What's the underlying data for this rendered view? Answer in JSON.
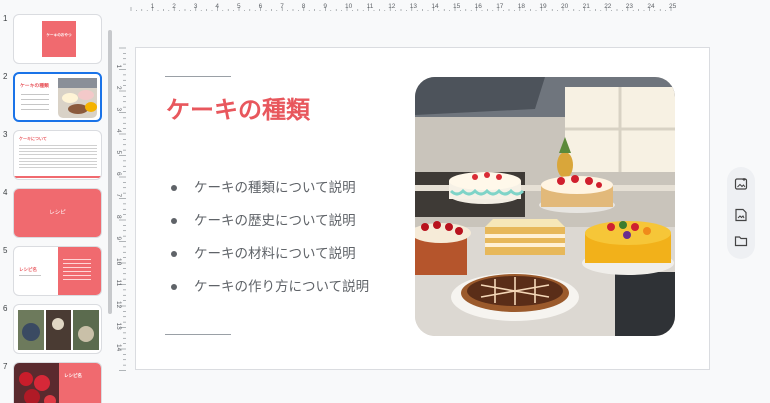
{
  "filmstrip": {
    "thumbnails": [
      {
        "num": "1",
        "title": "ケーキのおやつ",
        "kind": "title"
      },
      {
        "num": "2",
        "title": "ケーキの種類",
        "kind": "bullets-photo",
        "selected": true
      },
      {
        "num": "3",
        "title": "ケーキについて",
        "kind": "text"
      },
      {
        "num": "4",
        "title": "レシピ",
        "kind": "section"
      },
      {
        "num": "5",
        "title": "レシピ名",
        "kind": "split"
      },
      {
        "num": "6",
        "title": "",
        "kind": "gallery"
      },
      {
        "num": "7",
        "title": "レシピ名",
        "kind": "photo-split"
      }
    ]
  },
  "ruler": {
    "top_labels": [
      "1",
      "2",
      "3",
      "4",
      "5",
      "6",
      "7",
      "8",
      "9",
      "10",
      "11",
      "12",
      "13",
      "14",
      "15",
      "16",
      "17",
      "18",
      "19",
      "20",
      "21",
      "22",
      "23",
      "24",
      "25"
    ],
    "left_labels": [
      "1",
      "2",
      "3",
      "4",
      "5",
      "6",
      "7",
      "8",
      "9",
      "10",
      "11",
      "12",
      "13",
      "14"
    ]
  },
  "slide": {
    "title": "ケーキの種類",
    "bullets": [
      "ケーキの種類について説明",
      "ケーキの歴史について説明",
      "ケーキの材料について説明",
      "ケーキの作り方について説明"
    ],
    "image_icon": "cake-photo"
  },
  "side_panel": {
    "icons": [
      "add-image-icon",
      "insert-image-icon",
      "folder-icon"
    ]
  },
  "colors": {
    "accent": "#e8575d",
    "selection": "#1a73e8",
    "background": "#f8f9fa"
  }
}
